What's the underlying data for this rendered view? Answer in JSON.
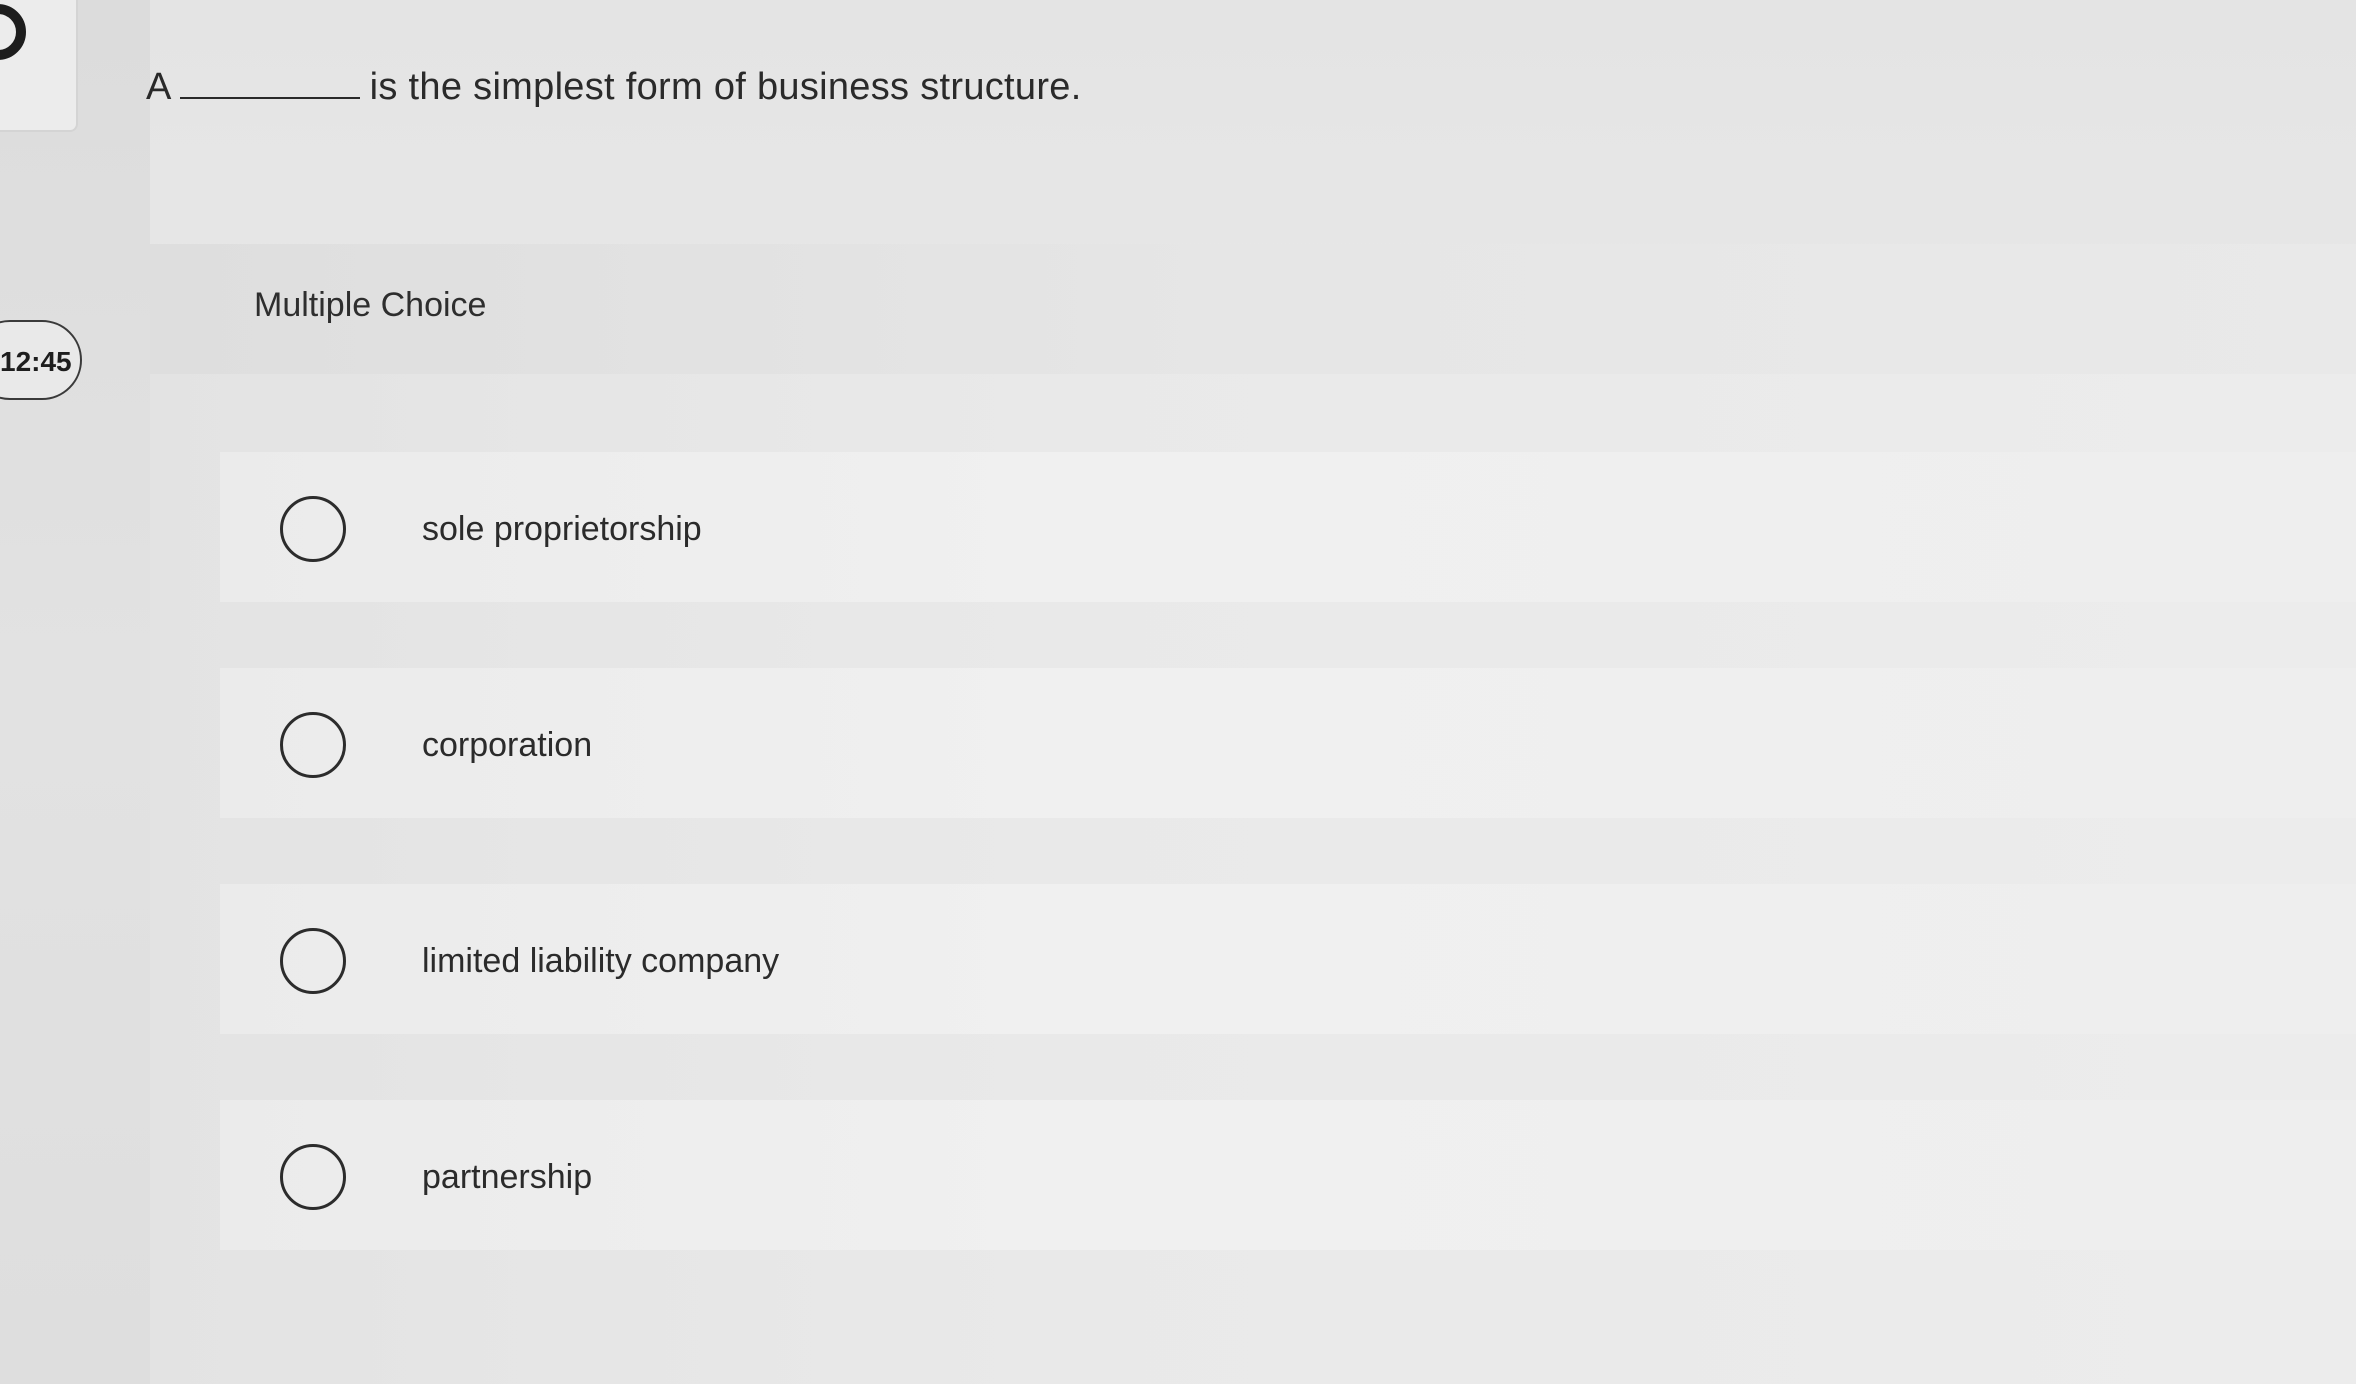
{
  "timer": {
    "time": "12:45"
  },
  "question": {
    "prefix": "A",
    "suffix": "is the simplest form of business structure."
  },
  "panel": {
    "title": "Multiple Choice"
  },
  "options": [
    {
      "label": "sole proprietorship"
    },
    {
      "label": "corporation"
    },
    {
      "label": "limited liability company"
    },
    {
      "label": "partnership"
    }
  ],
  "icons": {
    "corner": "circle-icon",
    "radio": "radio-button-icon"
  }
}
